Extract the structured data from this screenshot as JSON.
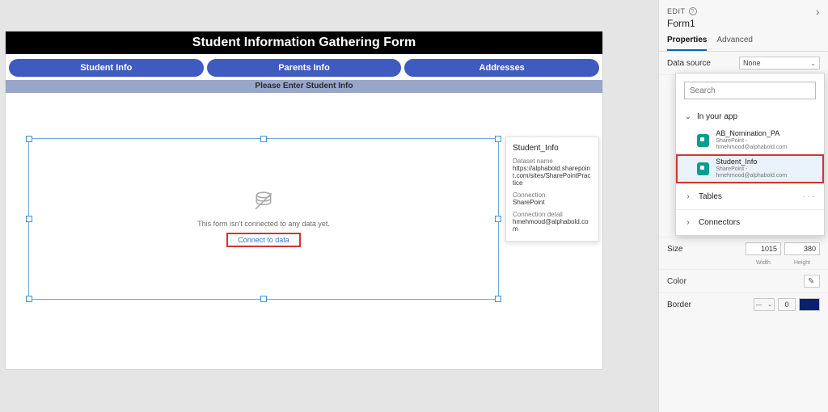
{
  "canvas": {
    "title": "Student Information Gathering Form",
    "tabs": [
      "Student Info",
      "Parents Info",
      "Addresses"
    ],
    "sub_bar": "Please Enter Student Info",
    "form_empty": {
      "text": "This form isn't connected to any data yet.",
      "link": "Connect to data"
    }
  },
  "tooltip": {
    "title": "Student_Info",
    "items": [
      {
        "label": "Dataset name",
        "value": "https://alphabold.sharepoint.com/sites/SharePointPractice"
      },
      {
        "label": "Connection",
        "value": "SharePoint"
      },
      {
        "label": "Connection detail",
        "value": "hmehmood@alphabold.com"
      }
    ]
  },
  "panel": {
    "edit": "EDIT",
    "element": "Form1",
    "tabs": {
      "properties": "Properties",
      "advanced": "Advanced"
    },
    "data_source_label": "Data source",
    "data_source_value": "None",
    "size_label": "Size",
    "size": {
      "width": "1015",
      "height": "380",
      "width_label": "Width",
      "height_label": "Height"
    },
    "color_label": "Color",
    "border_label": "Border",
    "border_width": "0",
    "border_color": "#0a1f6f"
  },
  "ds_popup": {
    "search_placeholder": "Search",
    "in_app_label": "In your app",
    "items": [
      {
        "name": "AB_Nomination_PA",
        "sub": "SharePoint - hmehmood@alphabold.com",
        "selected": false
      },
      {
        "name": "Student_Info",
        "sub": "SharePoint - hmehmood@alphabold.com",
        "selected": true
      }
    ],
    "tables_label": "Tables",
    "connectors_label": "Connectors"
  }
}
